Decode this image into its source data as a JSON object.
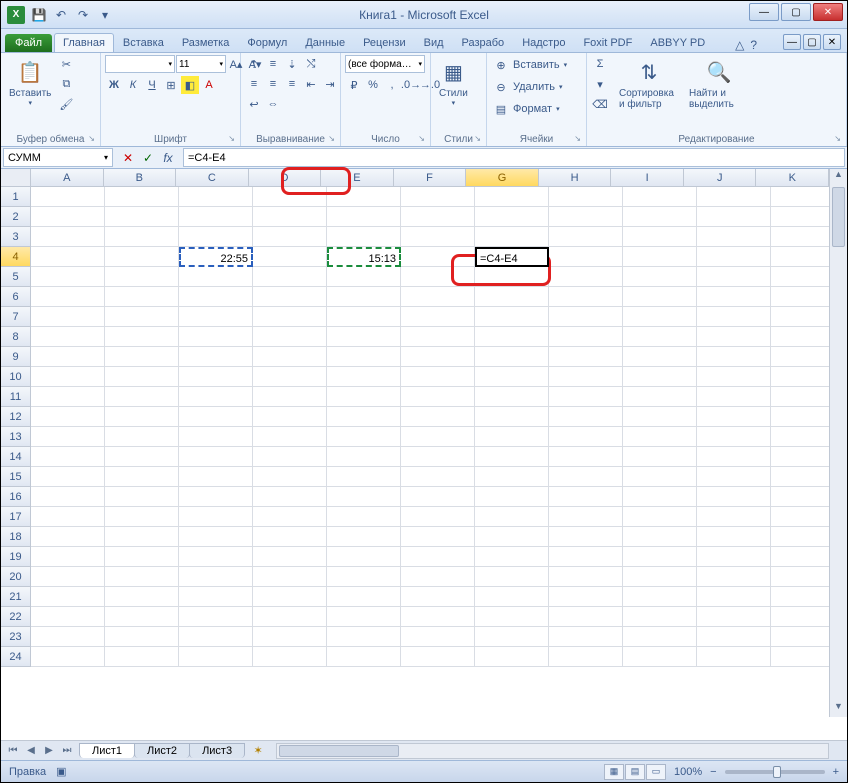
{
  "window": {
    "title": "Книга1  -  Microsoft Excel",
    "excel_glyph": "X"
  },
  "qat": {
    "save_glyph": "💾",
    "undo_glyph": "↶",
    "redo_glyph": "↷",
    "dd_glyph": "▾"
  },
  "winctrl": {
    "min": "—",
    "max": "▢",
    "close": "✕"
  },
  "tabs": {
    "file": "Файл",
    "items": [
      "Главная",
      "Вставка",
      "Разметка",
      "Формул",
      "Данные",
      "Рецензи",
      "Вид",
      "Разрабо",
      "Надстро",
      "Foxit PDF",
      "ABBYY PD"
    ],
    "active": "Главная",
    "help_glyph": "?",
    "collapse_glyph": "△"
  },
  "ribbon": {
    "clipboard": {
      "label": "Буфер обмена",
      "paste": "Вставить",
      "paste_glyph": "📋",
      "cut_glyph": "✂",
      "copy_glyph": "⧉",
      "brush_glyph": "🖌"
    },
    "font": {
      "label": "Шрифт",
      "name": "",
      "size": "11",
      "bold": "Ж",
      "italic": "К",
      "underline": "Ч",
      "border_glyph": "⊞",
      "fill_glyph": "◧",
      "color_glyph": "A",
      "grow_glyph": "A▴",
      "shrink_glyph": "A▾"
    },
    "align": {
      "label": "Выравнивание",
      "top": "⇡",
      "mid": "≡",
      "bot": "⇣",
      "left": "≡",
      "center": "≡",
      "right": "≡",
      "wrap_glyph": "↩",
      "merge_glyph": "⇔",
      "indent_dec": "⇤",
      "indent_inc": "⇥",
      "orient_glyph": "⤭"
    },
    "number": {
      "label": "Число",
      "format": "(все форма…",
      "currency_glyph": "₽",
      "percent_glyph": "%",
      "comma_glyph": ",",
      "inc_dec_glyph": ".0→",
      "dec_dec_glyph": "→.0"
    },
    "styles": {
      "label": "Стили",
      "btn": "Стили",
      "glyph": "▦"
    },
    "cells": {
      "label": "Ячейки",
      "insert": "Вставить",
      "insert_glyph": "⊕",
      "delete": "Удалить",
      "delete_glyph": "⊖",
      "format": "Формат",
      "format_glyph": "▤"
    },
    "editing": {
      "label": "Редактирование",
      "sum_glyph": "Σ",
      "fill_glyph": "▾",
      "clear_glyph": "⌫",
      "sort": "Сортировка и фильтр",
      "sort_glyph": "⇅",
      "find": "Найти и выделить",
      "find_glyph": "🔍"
    }
  },
  "name_box": {
    "value": "СУММ",
    "dd": "▾"
  },
  "fb": {
    "cancel": "✕",
    "enter": "✓",
    "fx": "fx"
  },
  "formula": {
    "value": "=C4-E4"
  },
  "columns": [
    "A",
    "B",
    "C",
    "D",
    "E",
    "F",
    "G",
    "H",
    "I",
    "J",
    "K"
  ],
  "active_col_index": 6,
  "rows": 24,
  "active_row": 4,
  "cells": {
    "C4": "22:55",
    "E4": "15:13",
    "G4": "=C4-E4"
  },
  "sheets": {
    "nav": [
      "⏮",
      "◀",
      "▶",
      "⏭"
    ],
    "tabs": [
      "Лист1",
      "Лист2",
      "Лист3"
    ],
    "active": "Лист1",
    "new_glyph": "✶"
  },
  "status": {
    "mode": "Правка",
    "macro_glyph": "▣",
    "views": [
      "▦",
      "▤",
      "▭"
    ],
    "zoom": "100%",
    "minus": "−",
    "plus": "+"
  },
  "scroll": {
    "up": "▲",
    "down": "▼",
    "thumb": ""
  }
}
